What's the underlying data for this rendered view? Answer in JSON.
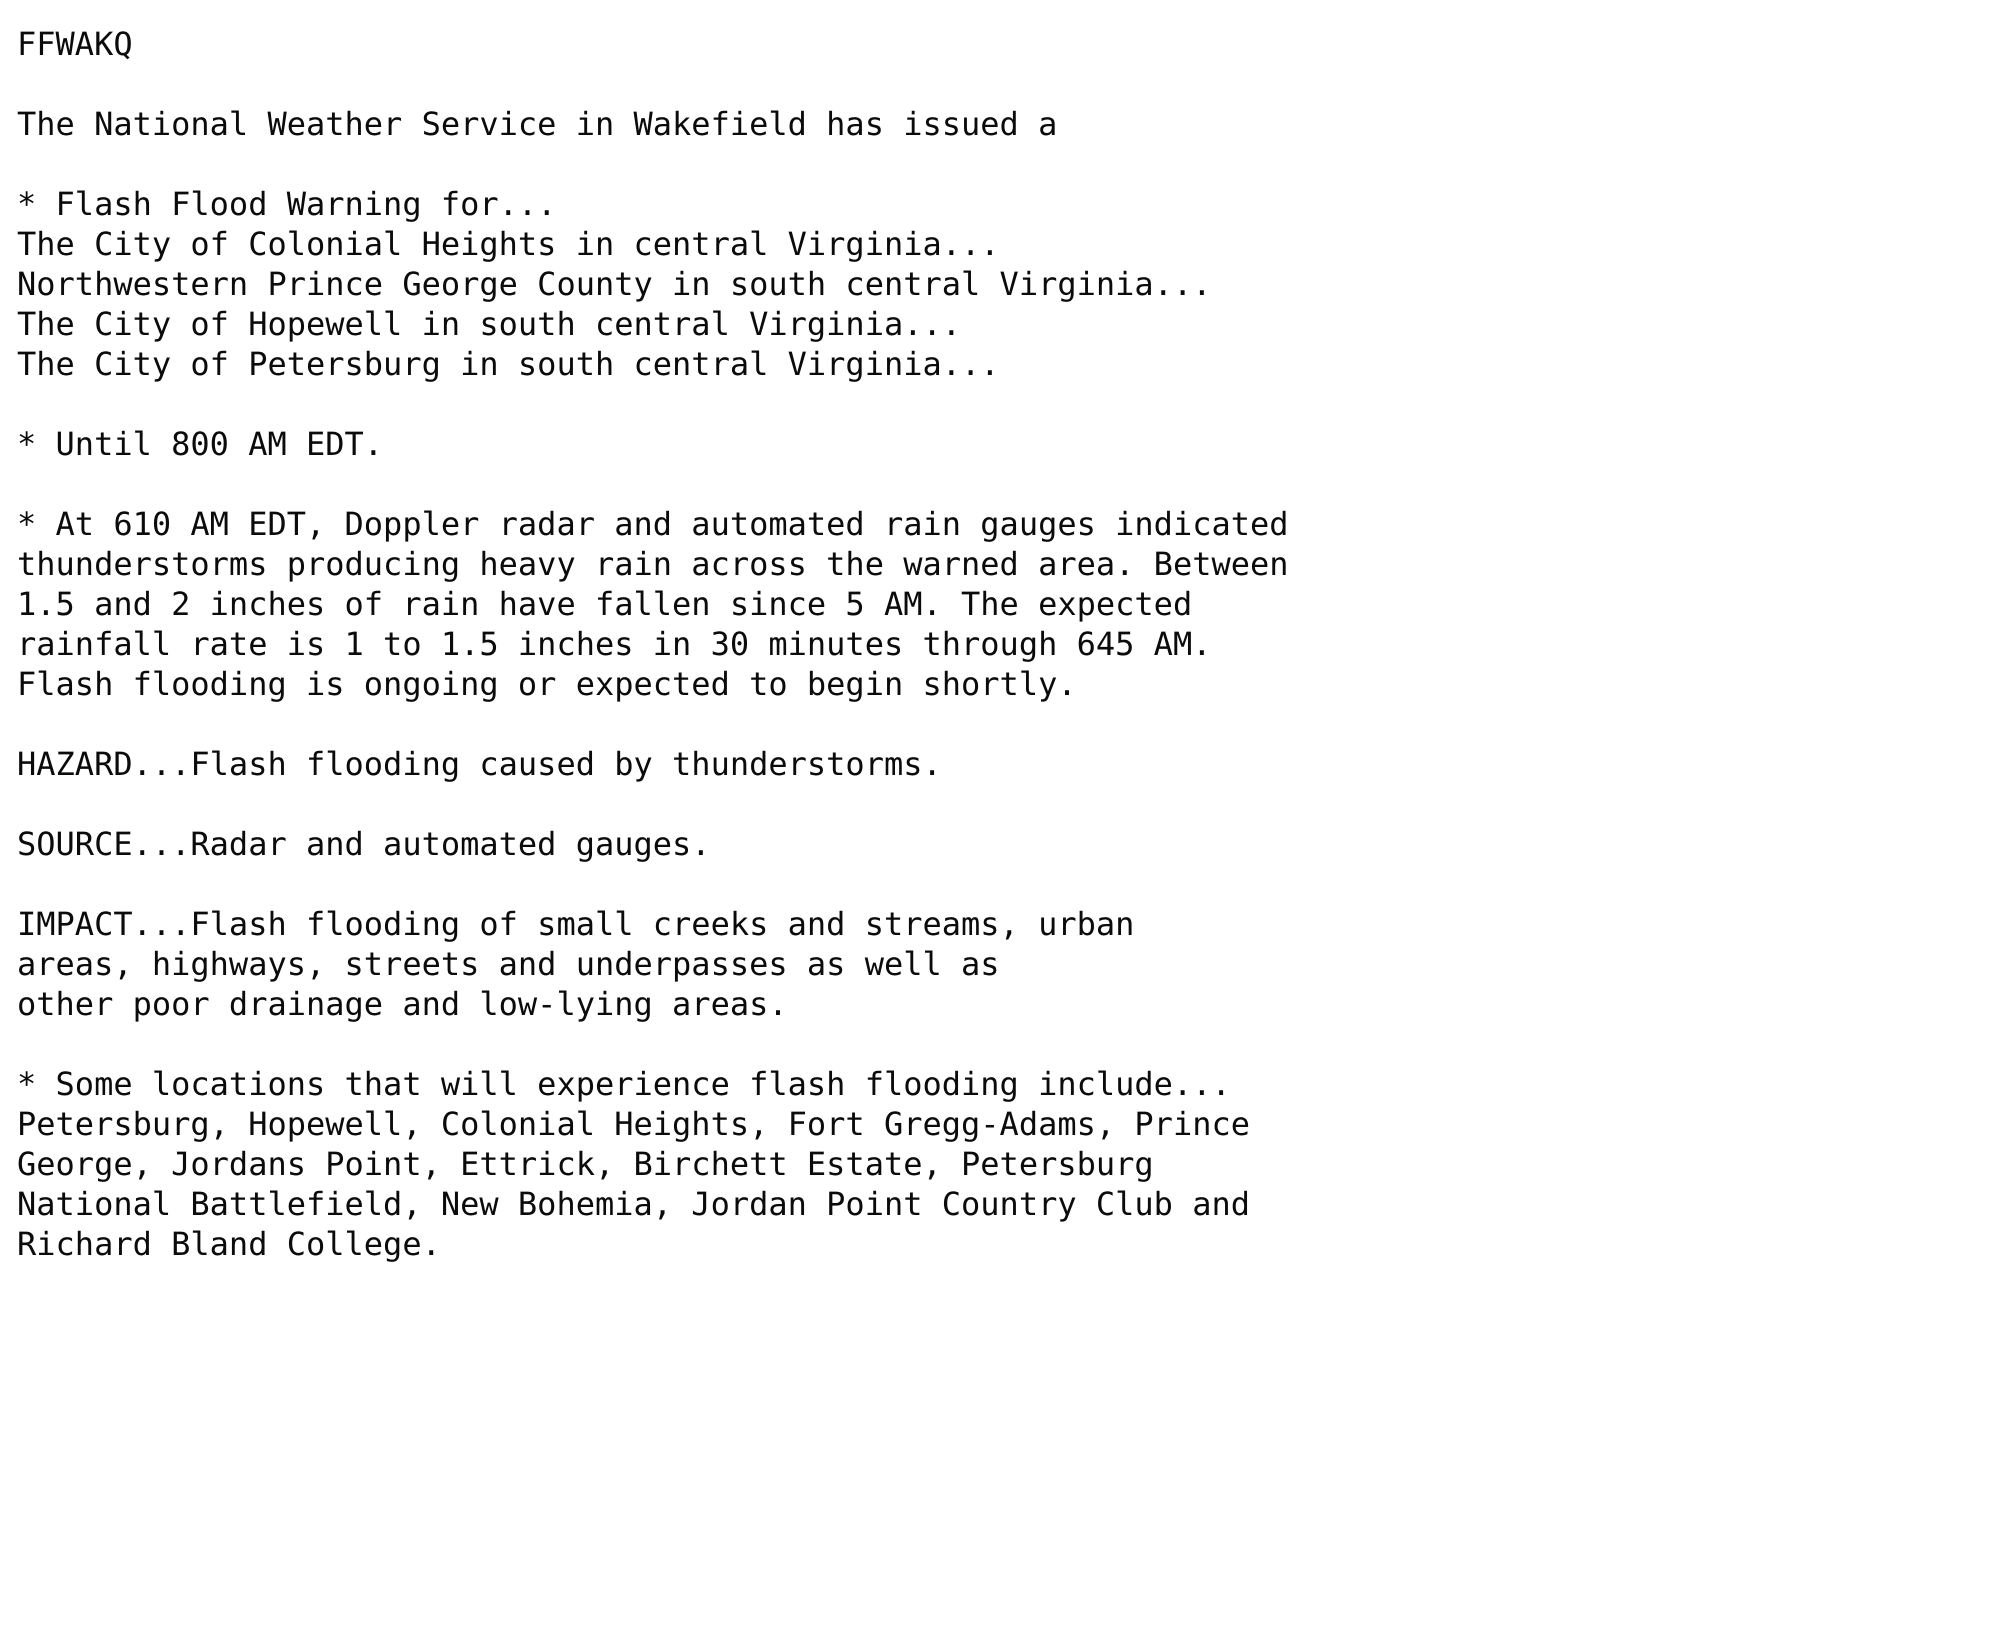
{
  "document": {
    "type": "nws-text-product",
    "background_color": "#ffffff",
    "text_color": "#0b0b0b",
    "product_id": "FFWAKQ",
    "issuing_office": "The National Weather Service in Wakefield has issued a",
    "headline_label": "* Flash Flood Warning for...",
    "areas": [
      "The City of Colonial Heights in central Virginia...",
      "Northwestern Prince George County in south central Virginia...",
      "The City of Hopewell in south central Virginia...",
      "The City of Petersburg in south central Virginia..."
    ],
    "expiration": "* Until 800 AM EDT.",
    "discussion": [
      "* At 610 AM EDT, Doppler radar and automated rain gauges indicated",
      "thunderstorms producing heavy rain across the warned area. Between",
      "1.5 and 2 inches of rain have fallen since 5 AM. The expected",
      "rainfall rate is 1 to 1.5 inches in 30 minutes through 645 AM.",
      "Flash flooding is ongoing or expected to begin shortly."
    ],
    "hazard": "HAZARD...Flash flooding caused by thunderstorms.",
    "source": "SOURCE...Radar and automated gauges.",
    "impact": [
      "IMPACT...Flash flooding of small creeks and streams, urban",
      "areas, highways, streets and underpasses as well as",
      "other poor drainage and low-lying areas."
    ],
    "locations_label": "* Some locations that will experience flash flooding include...",
    "locations": [
      "Petersburg, Hopewell, Colonial Heights, Fort Gregg-Adams, Prince",
      "George, Jordans Point, Ettrick, Birchett Estate, Petersburg",
      "National Battlefield, New Bohemia, Jordan Point Country Club and",
      "Richard Bland College."
    ]
  },
  "lines": [
    "FFWAKQ",
    "",
    "The National Weather Service in Wakefield has issued a",
    "",
    "* Flash Flood Warning for...",
    "The City of Colonial Heights in central Virginia...",
    "Northwestern Prince George County in south central Virginia...",
    "The City of Hopewell in south central Virginia...",
    "The City of Petersburg in south central Virginia...",
    "",
    "* Until 800 AM EDT.",
    "",
    "* At 610 AM EDT, Doppler radar and automated rain gauges indicated",
    "thunderstorms producing heavy rain across the warned area. Between",
    "1.5 and 2 inches of rain have fallen since 5 AM. The expected",
    "rainfall rate is 1 to 1.5 inches in 30 minutes through 645 AM.",
    "Flash flooding is ongoing or expected to begin shortly.",
    "",
    "HAZARD...Flash flooding caused by thunderstorms.",
    "",
    "SOURCE...Radar and automated gauges.",
    "",
    "IMPACT...Flash flooding of small creeks and streams, urban",
    "areas, highways, streets and underpasses as well as",
    "other poor drainage and low-lying areas.",
    "",
    "* Some locations that will experience flash flooding include...",
    "Petersburg, Hopewell, Colonial Heights, Fort Gregg-Adams, Prince",
    "George, Jordans Point, Ettrick, Birchett Estate, Petersburg",
    "National Battlefield, New Bohemia, Jordan Point Country Club and",
    "Richard Bland College."
  ]
}
